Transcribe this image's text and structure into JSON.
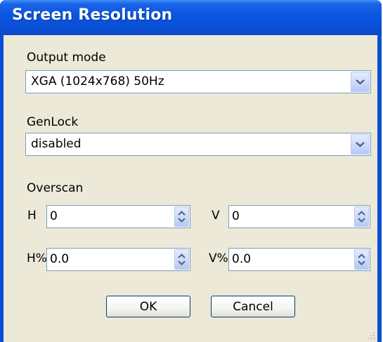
{
  "window": {
    "title": "Screen Resolution"
  },
  "output_mode": {
    "label": "Output mode",
    "value": "XGA (1024x768) 50Hz"
  },
  "genlock": {
    "label": "GenLock",
    "value": "disabled"
  },
  "overscan": {
    "label": "Overscan",
    "h_label": "H",
    "h_value": "0",
    "v_label": "V",
    "v_value": "0",
    "hpct_label": "H%",
    "hpct_value": "0.0",
    "vpct_label": "V%",
    "vpct_value": "0.0"
  },
  "buttons": {
    "ok": "OK",
    "cancel": "Cancel"
  },
  "colors": {
    "titlebar": "#0a55e0",
    "dialog_bg": "#ece9d8",
    "field_border": "#7f9db9"
  }
}
